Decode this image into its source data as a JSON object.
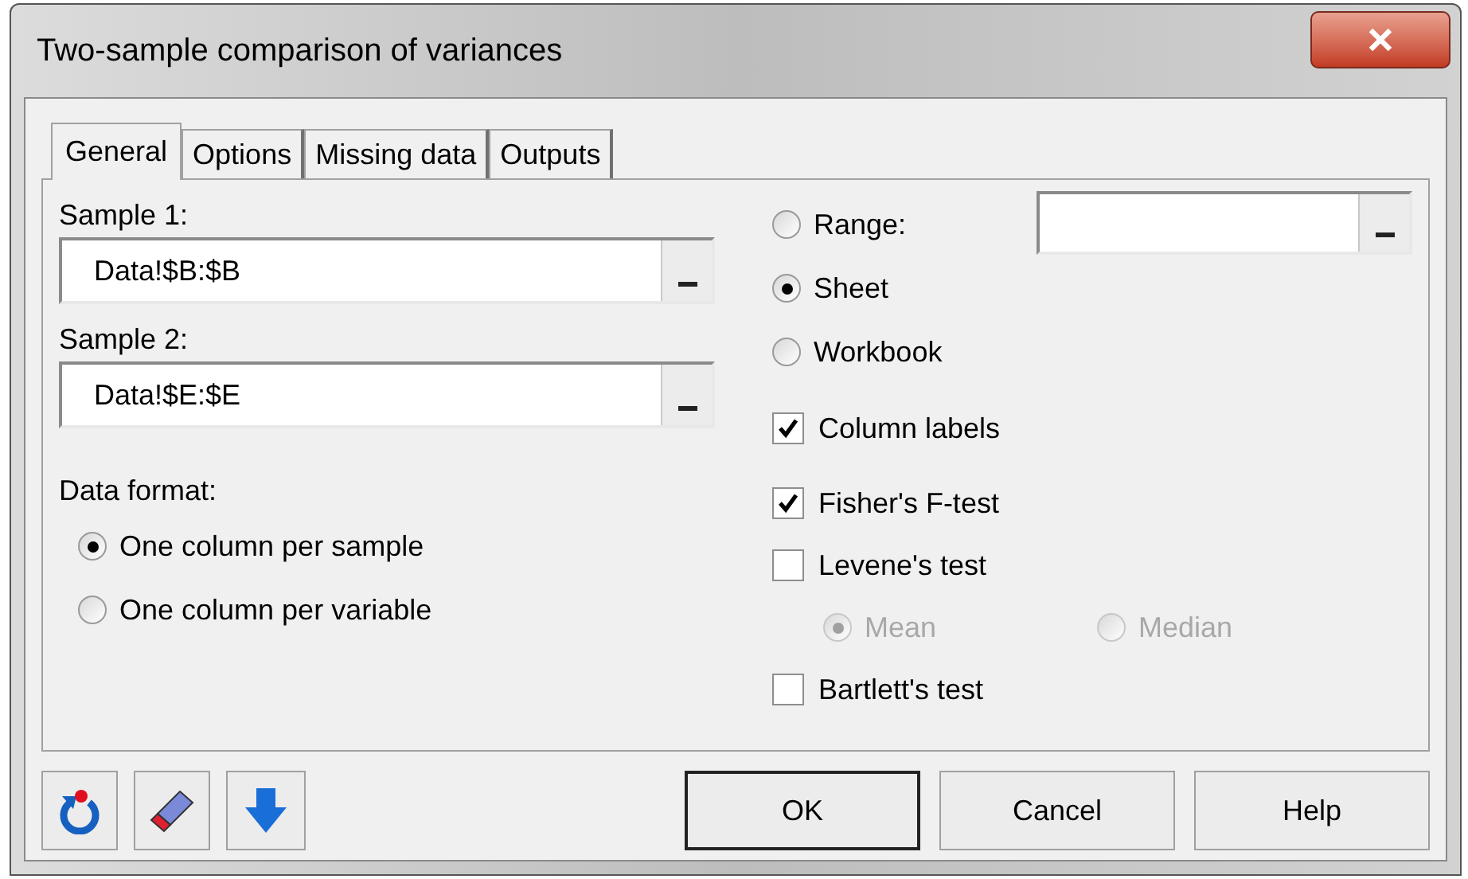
{
  "window": {
    "title": "Two-sample comparison of variances"
  },
  "tabs": [
    {
      "label": "General",
      "selected": true
    },
    {
      "label": "Options",
      "selected": false
    },
    {
      "label": "Missing data",
      "selected": false
    },
    {
      "label": "Outputs",
      "selected": false
    }
  ],
  "samples": [
    {
      "label": "Sample 1:",
      "value": "Data!$B:$B"
    },
    {
      "label": "Sample 2:",
      "value": "Data!$E:$E"
    }
  ],
  "data_format": {
    "label": "Data format:",
    "options": [
      {
        "label": "One column per sample",
        "selected": true
      },
      {
        "label": "One column per variable",
        "selected": false
      }
    ]
  },
  "destination": [
    {
      "label": "Range:",
      "selected": false,
      "kind": "range"
    },
    {
      "label": "Sheet",
      "selected": true,
      "kind": "plain"
    },
    {
      "label": "Workbook",
      "selected": false,
      "kind": "plain"
    }
  ],
  "column_labels": {
    "label": "Column labels",
    "checked": true
  },
  "tests": [
    {
      "label": "Fisher's F-test",
      "checked": true
    },
    {
      "label": "Levene's test",
      "checked": false,
      "options": [
        {
          "label": "Mean",
          "selected": true,
          "disabled": true
        },
        {
          "label": "Median",
          "selected": false,
          "disabled": true
        }
      ]
    },
    {
      "label": "Bartlett's test",
      "checked": false
    }
  ],
  "buttons": [
    {
      "label": "OK",
      "default": true
    },
    {
      "label": "Cancel",
      "default": false
    },
    {
      "label": "Help",
      "default": false
    }
  ]
}
